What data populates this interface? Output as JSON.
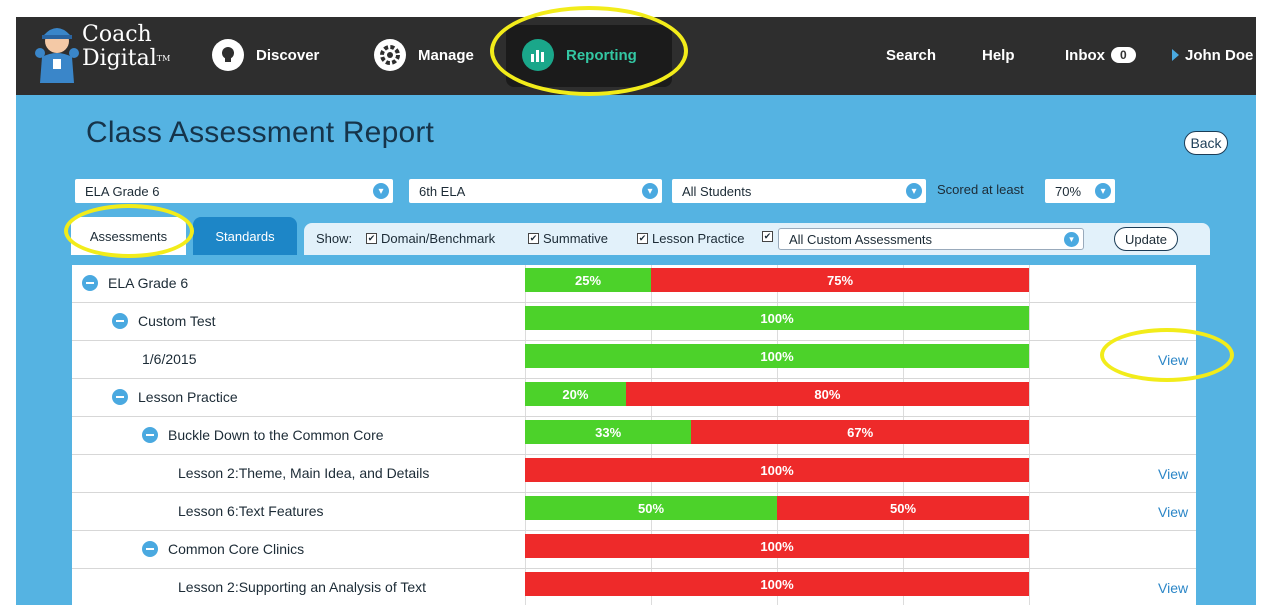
{
  "nav": {
    "logo_line1": "Coach",
    "logo_line2": "Digital",
    "logo_tm": "TM",
    "discover": "Discover",
    "manage": "Manage",
    "reporting": "Reporting",
    "search": "Search",
    "help": "Help",
    "inbox": "Inbox",
    "inbox_count": "0",
    "user": "John Doe"
  },
  "page": {
    "title": "Class Assessment Report",
    "back": "Back"
  },
  "filters": {
    "course": "ELA Grade 6",
    "class": "6th ELA",
    "students": "All Students",
    "scored_label": "Scored at least",
    "scored_value": "70%"
  },
  "tabs": {
    "assessments": "Assessments",
    "standards": "Standards"
  },
  "show": {
    "label": "Show:",
    "domain": "Domain/Benchmark",
    "summative": "Summative",
    "lesson": "Lesson Practice",
    "custom": "All Custom Assessments",
    "update": "Update"
  },
  "rows": [
    {
      "label": "ELA Grade 6",
      "green": "25%",
      "red": "75%",
      "view": ""
    },
    {
      "label": "Custom Test",
      "green": "100%",
      "red": "",
      "view": ""
    },
    {
      "label": "1/6/2015",
      "green": "100%",
      "red": "",
      "view": "View"
    },
    {
      "label": "Lesson Practice",
      "green": "20%",
      "red": "80%",
      "view": ""
    },
    {
      "label": "Buckle Down to the Common Core",
      "green": "33%",
      "red": "67%",
      "view": ""
    },
    {
      "label": "Lesson 2:Theme, Main Idea, and Details",
      "green": "",
      "red": "100%",
      "view": "View"
    },
    {
      "label": "Lesson 6:Text Features",
      "green": "50%",
      "red": "50%",
      "view": "View"
    },
    {
      "label": "Common Core Clinics",
      "green": "",
      "red": "100%",
      "view": ""
    },
    {
      "label": "Lesson 2:Supporting an Analysis of Text",
      "green": "",
      "red": "100%",
      "view": "View"
    }
  ],
  "colors": {
    "nav_bg": "#2e2e2e",
    "panel_bg": "#55b3e2",
    "green": "#4cd22a",
    "red": "#ee2a2a",
    "highlight": "#f2ec1a"
  }
}
